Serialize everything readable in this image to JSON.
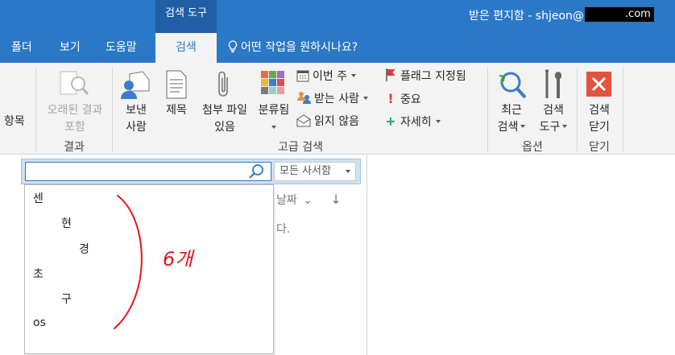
{
  "titlebar": {
    "context_tab": "검색 도구",
    "title_prefix": "받은 편지함 - shjeon@",
    "title_suffix": ".com"
  },
  "tabs": [
    {
      "label": "폴더"
    },
    {
      "label": "보기"
    },
    {
      "label": "도움말"
    },
    {
      "label": "검색"
    }
  ],
  "tellme": "어떤 작업을 원하시나요?",
  "ribbon": {
    "partial_left": "항목",
    "older_results": [
      "오래된 결과",
      "포함"
    ],
    "group_results": "결과",
    "sender": [
      "보낸",
      "사람"
    ],
    "subject": "제목",
    "has_attachments": [
      "첨부 파일",
      "있음"
    ],
    "categorized": "분류됨",
    "this_week": "이번 주",
    "sent_to": "받는 사람",
    "unread": "읽지 않음",
    "flagged": "플래그 지정됨",
    "important": "중요",
    "more": "자세히",
    "group_refine": "고급 검색",
    "recent_searches": [
      "최근",
      "검색"
    ],
    "search_tools": [
      "검색",
      "도구"
    ],
    "group_options": "옵션",
    "close_search": [
      "검색",
      "닫기"
    ],
    "group_close": "닫기"
  },
  "search": {
    "value": "",
    "scope": "모든 사서함"
  },
  "list": {
    "sort_label": "날짜",
    "empty_text": "다."
  },
  "dropdown": {
    "items": [
      "센",
      "현",
      "경",
      "초",
      "구",
      "os"
    ],
    "annotation": "6개"
  },
  "colors": {
    "accent": "#2b78c6",
    "context_tab": "#1f5fa6",
    "close_icon": "#e0533e",
    "flag": "#d83b3b",
    "annotation": "#e8141a"
  }
}
